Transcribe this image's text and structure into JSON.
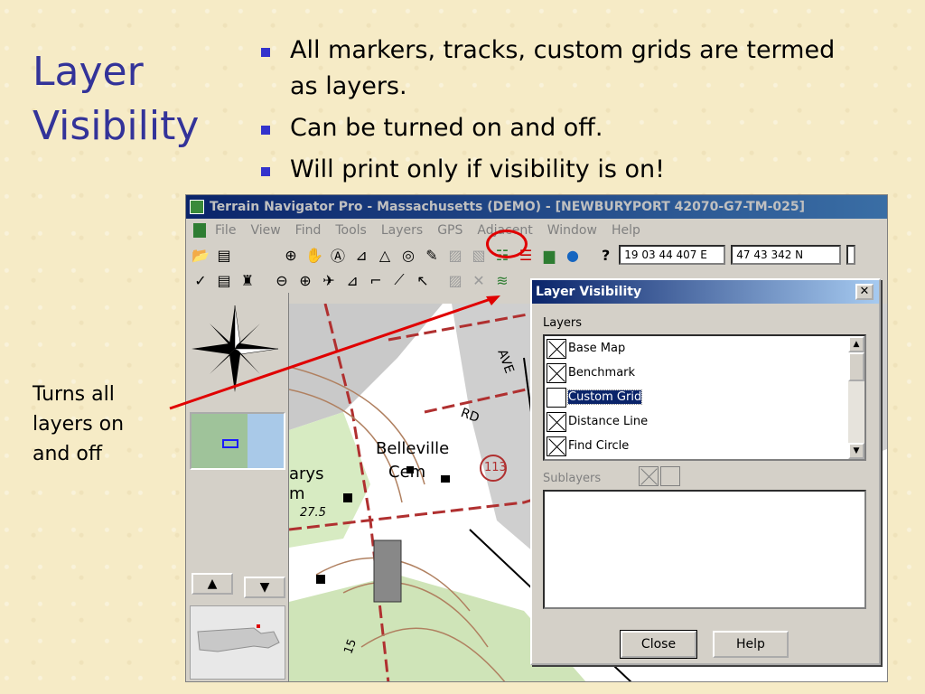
{
  "slide": {
    "title": "Layer\nVisibility",
    "bullets": [
      "All markers, tracks, custom grids are termed as layers.",
      "Can be turned on and off.",
      "Will print only if visibility is on!"
    ],
    "note": "Turns all\nlayers on\nand off",
    "bullet_color": "#3333cc",
    "title_color": "#333399",
    "pointer_color": "#e00000"
  },
  "app": {
    "title": "Terrain Navigator Pro - Massachusetts (DEMO) - [NEWBURYPORT 42070-G7-TM-025]",
    "menu": [
      "File",
      "View",
      "Find",
      "Tools",
      "Layers",
      "GPS",
      "Adjacent",
      "Window",
      "Help"
    ],
    "help_symbol": "?",
    "coord_east": "19 03 44 407 E",
    "coord_north": "47 43 342 N",
    "toolbar_icons_row1": [
      "open-folder-icon",
      "print-preview-icon",
      "zoom-in-icon",
      "hand-pan-icon",
      "text-label-icon",
      "ruler-icon",
      "triangle-marker-icon",
      "target-icon",
      "pencil-icon",
      "terrain-profile-icon",
      "terrain-3d-icon",
      "layer-visibility-icon",
      "layer-stack-icon",
      "layer-color-icon",
      "globe-icon"
    ],
    "toolbar_icons_row2": [
      "checkmark-icon",
      "print-icon",
      "binoculars-icon",
      "zoom-out-icon",
      "crosshair-icon",
      "gps-icon",
      "ruler-measure-icon",
      "route-icon",
      "line-draw-icon",
      "arrow-cursor-icon",
      "grid-icon",
      "delete-icon",
      "layers-toggle-icon"
    ],
    "map_labels": {
      "belleville": "Belleville",
      "cem": "Cem",
      "arys": "arys",
      "m": "m",
      "rd": "RD",
      "ave": "AVE",
      "route": "113",
      "elev": "27.5",
      "fifteen": "15"
    }
  },
  "dialog": {
    "title": "Layer Visibility",
    "close_glyph": "✕",
    "layers_label": "Layers",
    "layers": [
      {
        "label": "Base Map",
        "checked": true,
        "selected": false
      },
      {
        "label": "Benchmark",
        "checked": true,
        "selected": false
      },
      {
        "label": "Custom Grid",
        "checked": false,
        "selected": true
      },
      {
        "label": "Distance Line",
        "checked": true,
        "selected": false
      },
      {
        "label": "Find Circle",
        "checked": true,
        "selected": false
      }
    ],
    "sublayers_label": "Sublayers",
    "close_button": "Close",
    "help_button": "Help"
  }
}
